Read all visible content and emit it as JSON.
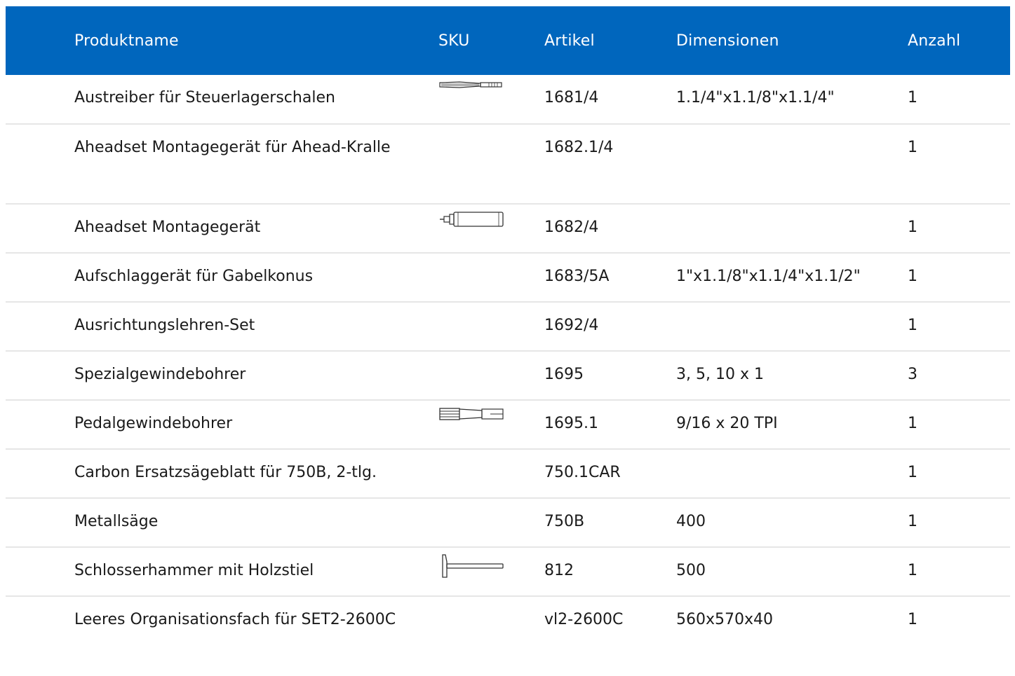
{
  "table": {
    "headers": [
      "Produktname",
      "SKU",
      "Artikel",
      "Dimensionen",
      "Anzahl"
    ],
    "rows": [
      {
        "name": "Austreiber für Steuerlagerschalen",
        "sku_icon": "pin-punch-icon",
        "artikel": "1681/4",
        "dimensionen": "1.1/4\"x1.1/8\"x1.1/4\"",
        "anzahl": "1"
      },
      {
        "name": "Aheadset Montagegerät für Ahead-Kralle",
        "sku_icon": "",
        "artikel": "1682.1/4",
        "dimensionen": "",
        "anzahl": "1"
      },
      {
        "name": "Aheadset Montagegerät",
        "sku_icon": "setting-tool-icon",
        "artikel": "1682/4",
        "dimensionen": "",
        "anzahl": "1"
      },
      {
        "name": "Aufschlaggerät für Gabelkonus",
        "sku_icon": "",
        "artikel": "1683/5A",
        "dimensionen": "1\"x1.1/8\"x1.1/4\"x1.1/2\"",
        "anzahl": "1"
      },
      {
        "name": "Ausrichtungslehren-Set",
        "sku_icon": "",
        "artikel": "1692/4",
        "dimensionen": "",
        "anzahl": "1"
      },
      {
        "name": "Spezialgewindebohrer",
        "sku_icon": "",
        "artikel": "1695",
        "dimensionen": "3, 5, 10 x 1",
        "anzahl": "3"
      },
      {
        "name": "Pedalgewindebohrer",
        "sku_icon": "tap-icon",
        "artikel": "1695.1",
        "dimensionen": "9/16 x 20 TPI",
        "anzahl": "1"
      },
      {
        "name": "Carbon Ersatzsägeblatt für 750B, 2-tlg.",
        "sku_icon": "",
        "artikel": "750.1CAR",
        "dimensionen": "",
        "anzahl": "1"
      },
      {
        "name": "Metallsäge",
        "sku_icon": "",
        "artikel": "750B",
        "dimensionen": "400",
        "anzahl": "1"
      },
      {
        "name": "Schlosserhammer mit Holzstiel",
        "sku_icon": "hammer-icon",
        "artikel": "812",
        "dimensionen": "500",
        "anzahl": "1"
      },
      {
        "name": "Leeres Organisationsfach für SET2-2600C",
        "sku_icon": "",
        "artikel": "vl2-2600C",
        "dimensionen": "560x570x40",
        "anzahl": "1"
      }
    ]
  },
  "colors": {
    "header_bg": "#0066bd",
    "header_text": "#ffffff",
    "divider": "#e6e6e6"
  }
}
